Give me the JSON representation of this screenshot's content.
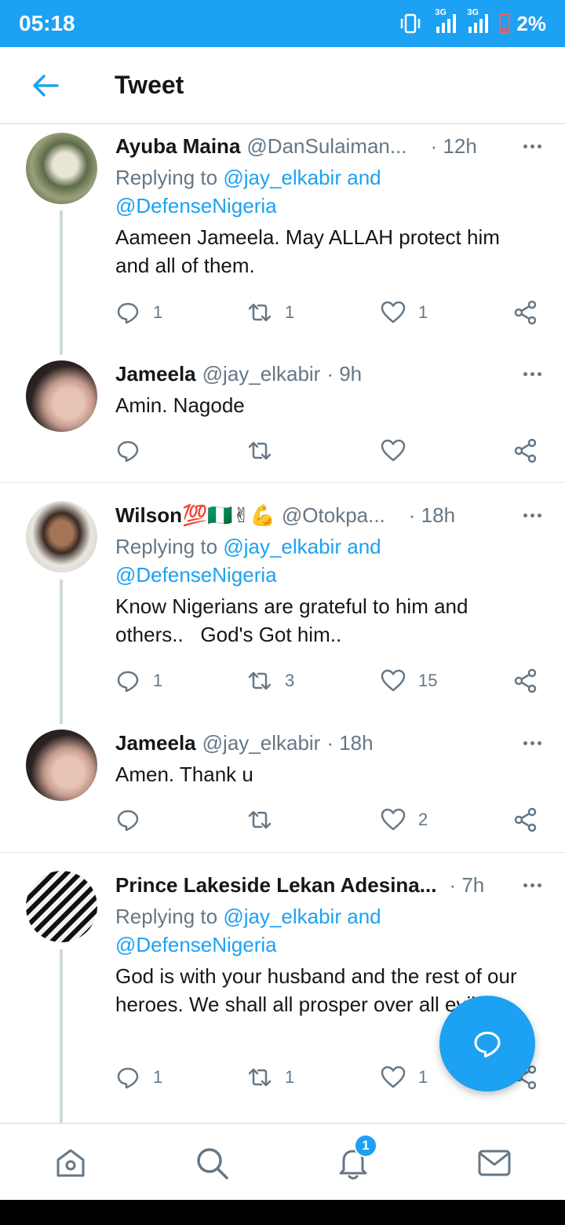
{
  "status_bar": {
    "time": "05:18",
    "network_1": "3G",
    "network_2": "3G",
    "battery": "2%"
  },
  "header": {
    "title": "Tweet"
  },
  "tweets": [
    {
      "name": "Ayuba Maina",
      "handle": "@DanSulaiman...",
      "time": "· 12h",
      "replying_prefix": "Replying to",
      "mention_1": "@jay_elkabir",
      "mention_and": "and",
      "mention_2": "@DefenseNigeria",
      "text": "Aameen Jameela. May ALLAH protect him and all of them.",
      "replies": "1",
      "retweets": "1",
      "likes": "1"
    },
    {
      "name": "Jameela",
      "handle": "@jay_elkabir",
      "time": "· 9h",
      "text": "Amin. Nagode",
      "replies": "",
      "retweets": "",
      "likes": ""
    },
    {
      "name": "Wilson💯🇳🇬✌💪",
      "handle": "@Otokpa...",
      "time": "· 18h",
      "replying_prefix": "Replying to",
      "mention_1": "@jay_elkabir",
      "mention_and": "and",
      "mention_2": "@DefenseNigeria",
      "text": "Know Nigerians are grateful to him and others..   God's Got him..",
      "replies": "1",
      "retweets": "3",
      "likes": "15"
    },
    {
      "name": "Jameela",
      "handle": "@jay_elkabir",
      "time": "· 18h",
      "text": "Amen. Thank u",
      "replies": "",
      "retweets": "",
      "likes": "2"
    },
    {
      "name": "Prince Lakeside Lekan Adesina...",
      "handle": "",
      "time": "· 7h",
      "replying_prefix": "Replying to",
      "mention_1": "@jay_elkabir",
      "mention_and": "and",
      "mention_2": "@DefenseNigeria",
      "text": "God is with your husband and the rest of our heroes. We shall all prosper over all evils.",
      "replies": "1",
      "retweets": "1",
      "likes": "1"
    }
  ],
  "bottom_nav": {
    "notification_badge": "1"
  },
  "colors": {
    "accent": "#1da1f2",
    "text": "#14171a",
    "muted": "#657786",
    "divider": "#e1e8ed"
  }
}
